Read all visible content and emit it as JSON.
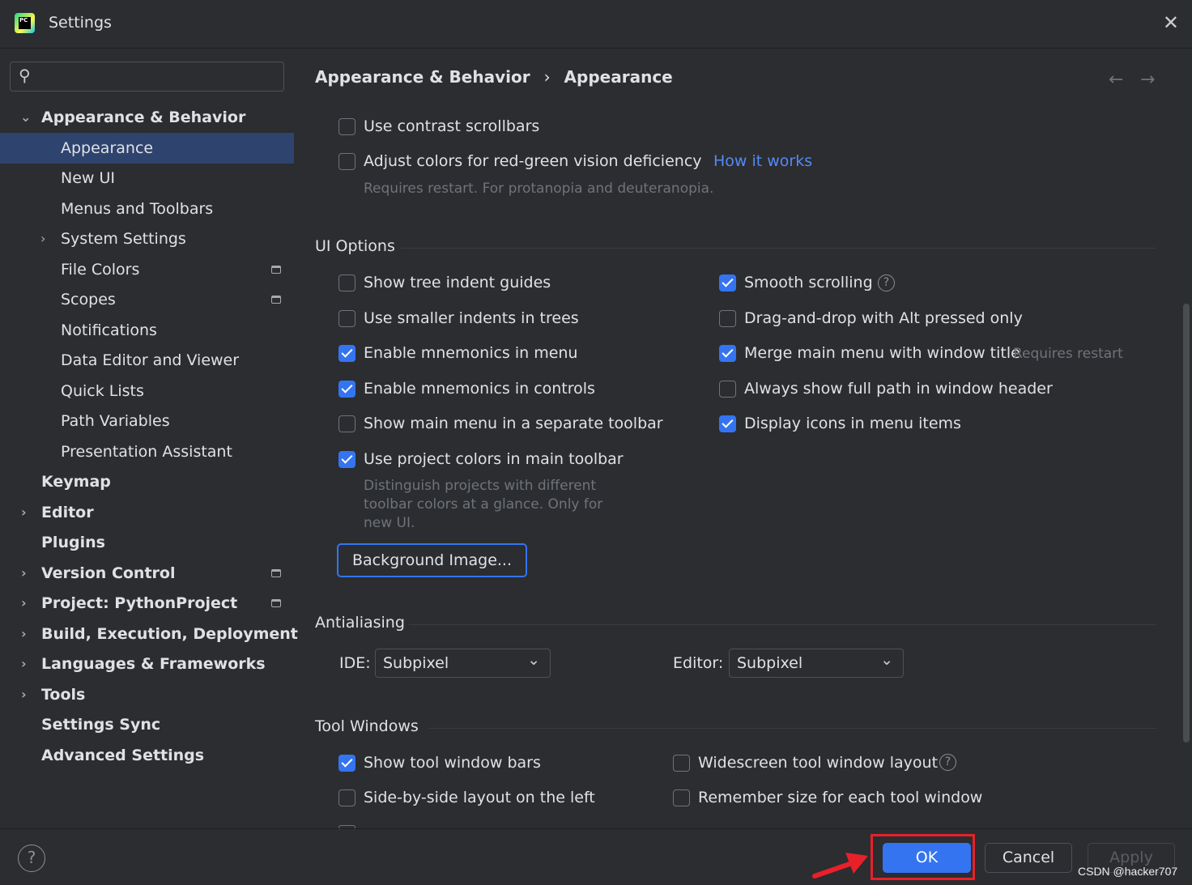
{
  "window": {
    "title": "Settings",
    "logo_text": "PC"
  },
  "search": {
    "placeholder": ""
  },
  "sidebar": {
    "items": [
      {
        "label": "Appearance & Behavior",
        "level": 0,
        "expanded": true
      },
      {
        "label": "Appearance",
        "level": 1,
        "selected": true
      },
      {
        "label": "New UI",
        "level": 1
      },
      {
        "label": "Menus and Toolbars",
        "level": 1
      },
      {
        "label": "System Settings",
        "level": 1,
        "collapsed": true
      },
      {
        "label": "File Colors",
        "level": 1,
        "project": true
      },
      {
        "label": "Scopes",
        "level": 1,
        "project": true
      },
      {
        "label": "Notifications",
        "level": 1
      },
      {
        "label": "Data Editor and Viewer",
        "level": 1
      },
      {
        "label": "Quick Lists",
        "level": 1
      },
      {
        "label": "Path Variables",
        "level": 1
      },
      {
        "label": "Presentation Assistant",
        "level": 1
      },
      {
        "label": "Keymap",
        "level": 0
      },
      {
        "label": "Editor",
        "level": 0,
        "collapsed": true
      },
      {
        "label": "Plugins",
        "level": 0
      },
      {
        "label": "Version Control",
        "level": 0,
        "collapsed": true,
        "project": true
      },
      {
        "label": "Project: PythonProject",
        "level": 0,
        "collapsed": true,
        "project": true
      },
      {
        "label": "Build, Execution, Deployment",
        "level": 0,
        "collapsed": true
      },
      {
        "label": "Languages & Frameworks",
        "level": 0,
        "collapsed": true
      },
      {
        "label": "Tools",
        "level": 0,
        "collapsed": true
      },
      {
        "label": "Settings Sync",
        "level": 0
      },
      {
        "label": "Advanced Settings",
        "level": 0
      }
    ]
  },
  "breadcrumb": {
    "parent": "Appearance & Behavior",
    "separator": "›",
    "current": "Appearance"
  },
  "top_options": {
    "contrast": {
      "label": "Use contrast scrollbars",
      "checked": false
    },
    "redgreen": {
      "label": "Adjust colors for red-green vision deficiency",
      "checked": false,
      "link": "How it works",
      "note": "Requires restart. For protanopia and deuteranopia."
    }
  },
  "ui_options": {
    "title": "UI Options",
    "left": [
      {
        "label": "Show tree indent guides",
        "checked": false
      },
      {
        "label": "Use smaller indents in trees",
        "checked": false
      },
      {
        "label": "Enable mnemonics in menu",
        "checked": true
      },
      {
        "label": "Enable mnemonics in controls",
        "checked": true
      },
      {
        "label": "Show main menu in a separate toolbar",
        "checked": false
      },
      {
        "label": "Use project colors in main toolbar",
        "checked": true
      }
    ],
    "project_colors_note": [
      "Distinguish projects with different",
      "toolbar colors at a glance. Only for",
      "new UI."
    ],
    "right": [
      {
        "label": "Smooth scrolling",
        "checked": true
      },
      {
        "label": "Drag-and-drop with Alt pressed only",
        "checked": false
      },
      {
        "label": "Merge main menu with window title",
        "checked": true,
        "note": "Requires restart"
      },
      {
        "label": "Always show full path in window header",
        "checked": false
      },
      {
        "label": "Display icons in menu items",
        "checked": true
      }
    ],
    "background_button": "Background Image..."
  },
  "antialiasing": {
    "title": "Antialiasing",
    "ide_label": "IDE:",
    "ide_value": "Subpixel",
    "editor_label": "Editor:",
    "editor_value": "Subpixel"
  },
  "tool_windows": {
    "title": "Tool Windows",
    "items": [
      {
        "label": "Show tool window bars",
        "checked": true
      },
      {
        "label": "Widescreen tool window layout",
        "checked": false
      },
      {
        "label": "Side-by-side layout on the left",
        "checked": false
      },
      {
        "label": "Remember size for each tool window",
        "checked": false
      }
    ]
  },
  "footer": {
    "help": "?",
    "ok": "OK",
    "cancel": "Cancel",
    "apply": "Apply"
  },
  "watermark": "CSDN @hacker707",
  "colors": {
    "accent": "#3574f0",
    "selection": "#2e436e",
    "link": "#548af7",
    "annotation": "#e8202a"
  }
}
